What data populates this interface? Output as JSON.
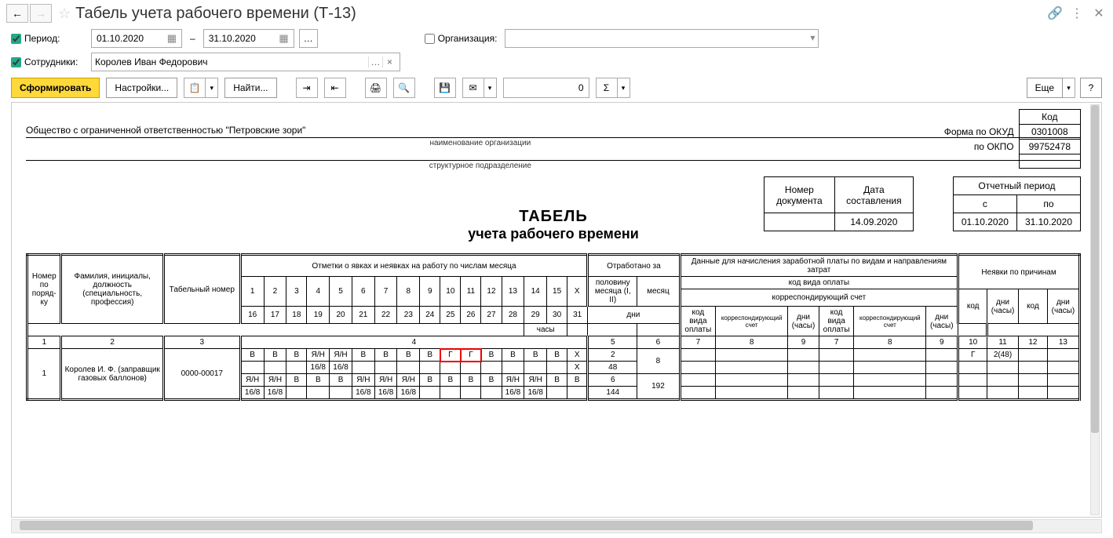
{
  "title": "Табель учета рабочего времени (Т-13)",
  "filters": {
    "period_label": "Период:",
    "date_from": "01.10.2020",
    "date_to": "31.10.2020",
    "dash": "–",
    "employees_label": "Сотрудники:",
    "employee_value": "Королев Иван Федорович",
    "org_label": "Организация:"
  },
  "toolbar": {
    "generate": "Сформировать",
    "settings": "Настройки...",
    "find": "Найти...",
    "numvalue": "0",
    "more": "Еще",
    "help": "?"
  },
  "report": {
    "org_name": "Общество с ограниченной ответственностью \"Петровские зори\"",
    "org_caption": "наименование организации",
    "subunit_caption": "структурное подразделение",
    "code_header": "Код",
    "okud_label": "Форма по ОКУД",
    "okud": "0301008",
    "okpo_label": "по ОКПО",
    "okpo": "99752478",
    "docnum_head": "Номер документа",
    "docnum": "",
    "docdate_head": "Дата составления",
    "docdate": "14.09.2020",
    "period_head": "Отчетный период",
    "period_from_head": "с",
    "period_to_head": "по",
    "period_from": "01.10.2020",
    "period_to": "31.10.2020",
    "title1": "ТАБЕЛЬ",
    "title2": "учета  рабочего времени"
  },
  "header": {
    "c1": "Номер по поряд-ку",
    "c2": "Фамилия, инициалы, должность (специальность, профессия)",
    "c3": "Табельный номер",
    "marks": "Отметки о явках и неявках на работу по числам месяца",
    "worked": "Отработано за",
    "half": "половину месяца (I, II)",
    "month": "месяц",
    "days": "дни",
    "hours": "часы",
    "pay": "Данные для начисления заработной платы по видам и направлениям затрат",
    "paycode": "код вида оплаты",
    "corr": "корреспондирующий счет",
    "daysh": "дни (часы)",
    "absent": "Неявки по причинам",
    "code": "код",
    "x": "X",
    "d1": "1",
    "d2": "2",
    "d3": "3",
    "d4": "4",
    "d5": "5",
    "d6": "6",
    "d7": "7",
    "d8": "8",
    "d9": "9",
    "d10": "10",
    "d11": "11",
    "d12": "12",
    "d13": "13",
    "d14": "14",
    "d15": "15",
    "d16": "16",
    "d17": "17",
    "d18": "18",
    "d19": "19",
    "d20": "20",
    "d21": "21",
    "d22": "22",
    "d23": "23",
    "d24": "24",
    "d25": "25",
    "d26": "26",
    "d27": "27",
    "d28": "28",
    "d29": "29",
    "d30": "30",
    "d31": "31",
    "n1": "1",
    "n2": "2",
    "n3": "3",
    "n4": "4",
    "n5": "5",
    "n6": "6",
    "n7": "7",
    "n8": "8",
    "n9": "9",
    "n10": "10",
    "n11": "11",
    "n12": "12",
    "n13": "13"
  },
  "row": {
    "num": "1",
    "name": "Королев И. Ф. (заправщик газовых баллонов)",
    "tabnum": "0000-00017",
    "r1": [
      "В",
      "В",
      "В",
      "Я/Н",
      "Я/Н",
      "В",
      "В",
      "В",
      "В",
      "Г",
      "Г",
      "В",
      "В",
      "В",
      "В",
      "X"
    ],
    "r1h": [
      "",
      "",
      "",
      "16/8",
      "16/8",
      "",
      "",
      "",
      "",
      "",
      "",
      "",
      "",
      "",
      "",
      "X"
    ],
    "r2": [
      "Я/Н",
      "Я/Н",
      "В",
      "В",
      "В",
      "Я/Н",
      "Я/Н",
      "Я/Н",
      "В",
      "В",
      "В",
      "В",
      "Я/Н",
      "Я/Н",
      "В",
      "В"
    ],
    "r2h": [
      "16/8",
      "16/8",
      "",
      "",
      "",
      "16/8",
      "16/8",
      "16/8",
      "",
      "",
      "",
      "",
      "16/8",
      "16/8",
      "",
      ""
    ],
    "half1_days": "2",
    "half1_hours": "48",
    "half2_days": "6",
    "half2_hours": "144",
    "month_days": "8",
    "month_hours": "192",
    "abs_code": "Г",
    "abs_days": "2(48)"
  }
}
